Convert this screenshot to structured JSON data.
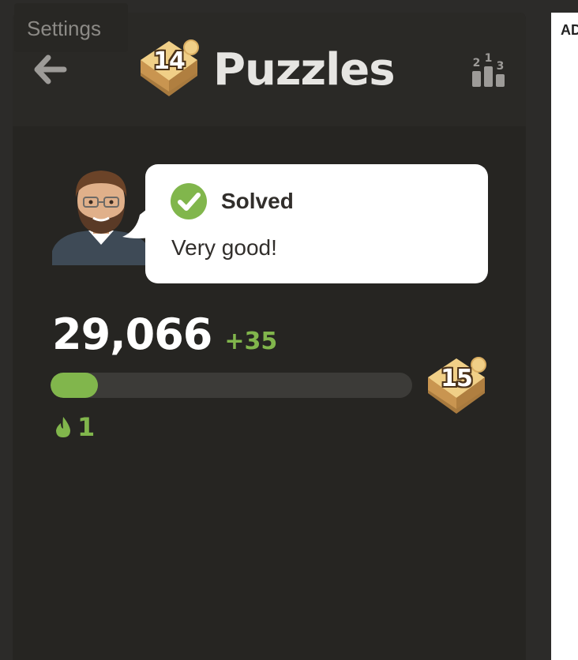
{
  "header": {
    "title": "Puzzles",
    "level_badge": "14",
    "back_icon": "arrow-left-icon",
    "leaderboard_icon": "leaderboard-podium-icon"
  },
  "tooltip": {
    "text": "Settings"
  },
  "result": {
    "status": "Solved",
    "message": "Very good!",
    "status_icon": "checkmark-circle-icon"
  },
  "stats": {
    "rating": "29,066",
    "rating_change": "+35",
    "progress_fraction": 0.125,
    "next_level_badge": "15",
    "streak_count": "1",
    "streak_icon": "flame-icon"
  },
  "ad": {
    "label": "AD"
  },
  "colors": {
    "accent_green": "#81b64c",
    "background": "#262522",
    "badge_gold": "#e2b96b"
  }
}
